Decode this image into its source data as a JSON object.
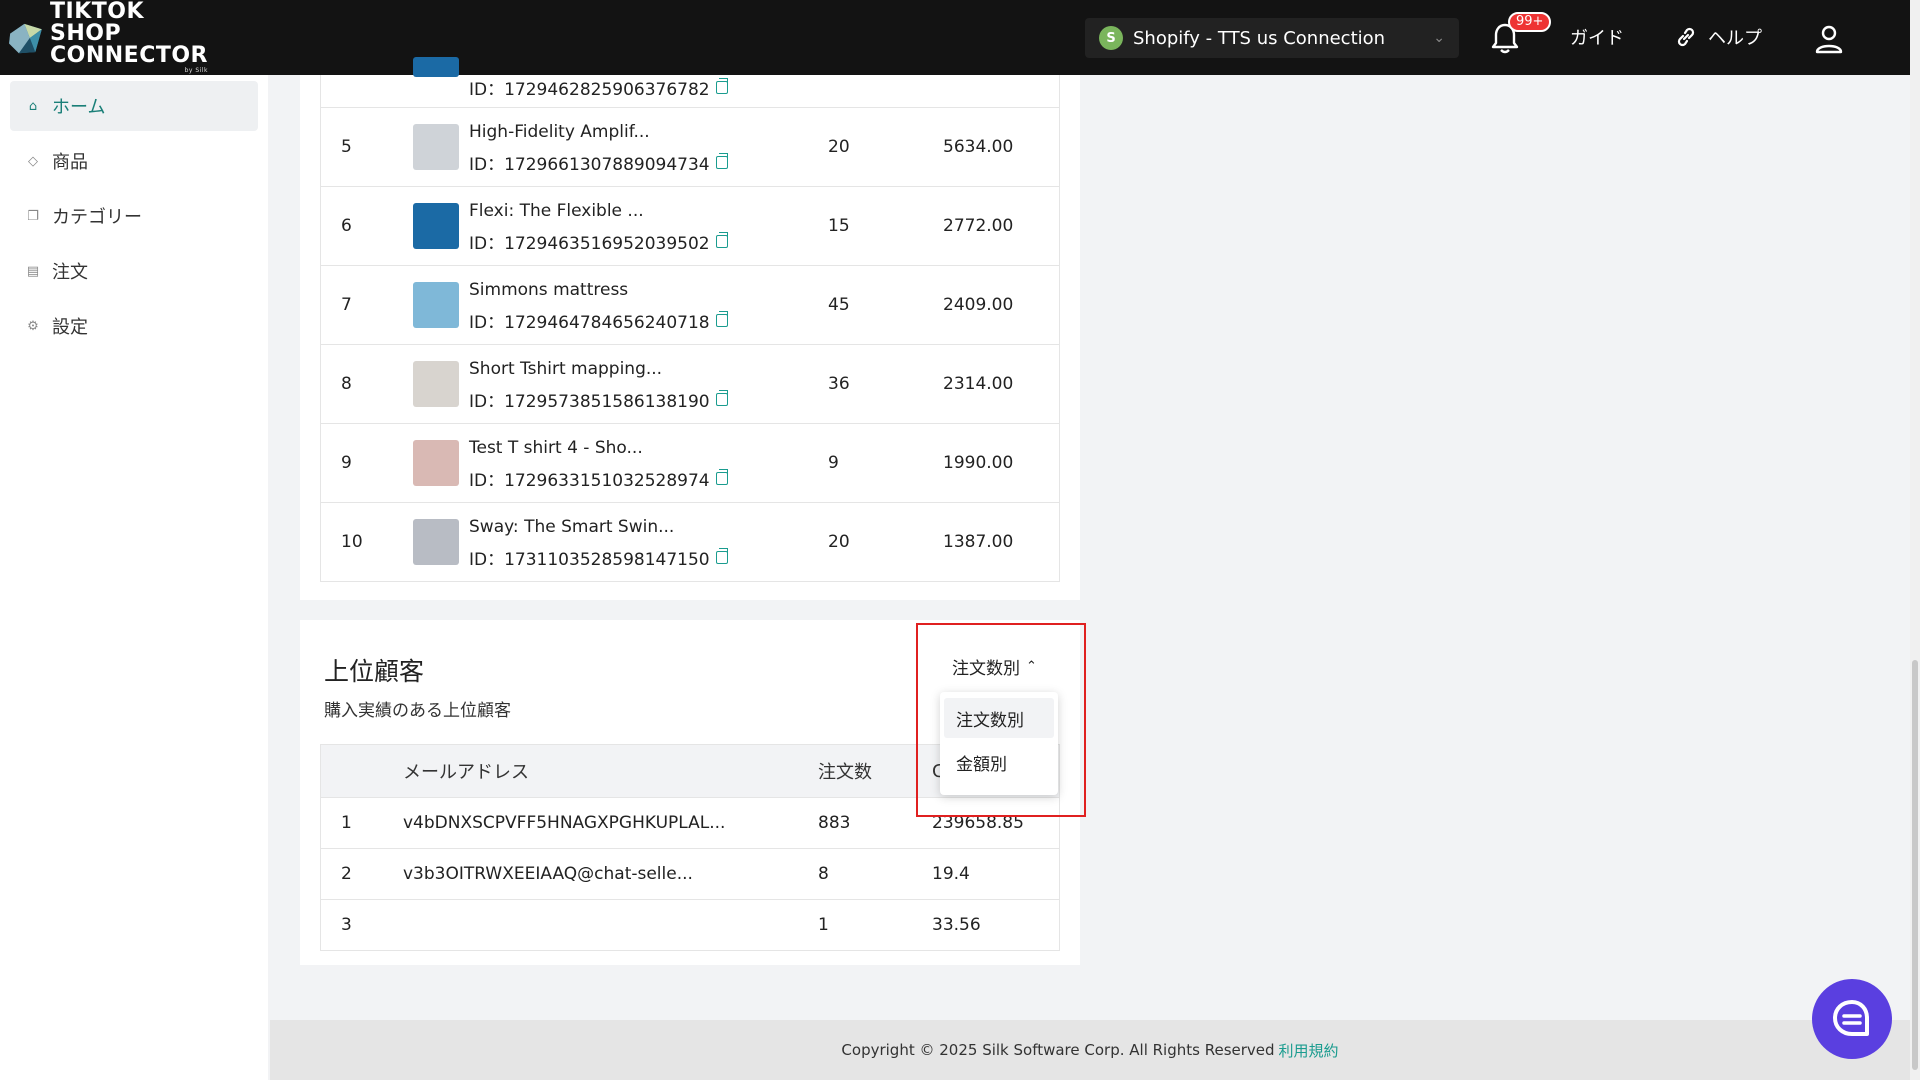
{
  "header": {
    "logo_line1": "TIKTOK SHOP",
    "logo_line2": "CONNECTOR",
    "logo_by": "by Silk",
    "store_name": "Shopify - TTS us Connection",
    "notification_badge": "99+",
    "guide_label": "ガイド",
    "help_label": "ヘルプ"
  },
  "sidebar": {
    "items": [
      {
        "label": "ホーム",
        "icon": "home-icon"
      },
      {
        "label": "商品",
        "icon": "tag-icon"
      },
      {
        "label": "カテゴリー",
        "icon": "category-icon"
      },
      {
        "label": "注文",
        "icon": "order-icon"
      },
      {
        "label": "設定",
        "icon": "settings-icon"
      }
    ]
  },
  "products": {
    "partial_id": "ID：1729462825906376782",
    "rows": [
      {
        "rank": "5",
        "name": "High-Fidelity Amplif...",
        "id": "ID：1729661307889094734",
        "qty": "20",
        "amount": "5634.00",
        "thumb": "#cfd3d8"
      },
      {
        "rank": "6",
        "name": "Flexi: The Flexible ...",
        "id": "ID：1729463516952039502",
        "qty": "15",
        "amount": "2772.00",
        "thumb": "#1b6aa5"
      },
      {
        "rank": "7",
        "name": "Simmons mattress",
        "id": "ID：1729464784656240718",
        "qty": "45",
        "amount": "2409.00",
        "thumb": "#7fb8d8"
      },
      {
        "rank": "8",
        "name": "Short Tshirt mapping...",
        "id": "ID：1729573851586138190",
        "qty": "36",
        "amount": "2314.00",
        "thumb": "#d8d4cf"
      },
      {
        "rank": "9",
        "name": "Test T shirt 4 - Sho...",
        "id": "ID：1729633151032528974",
        "qty": "9",
        "amount": "1990.00",
        "thumb": "#d9b9b4"
      },
      {
        "rank": "10",
        "name": "Sway: The Smart Swin...",
        "id": "ID：1731103528598147150",
        "qty": "20",
        "amount": "1387.00",
        "thumb": "#b8bcc4"
      }
    ]
  },
  "customers": {
    "title": "上位顧客",
    "subtitle": "購入実績のある上位顧客",
    "sort_label": "注文数別",
    "headers": {
      "email": "メールアドレス",
      "orders": "注文数",
      "amount": "C"
    },
    "rows": [
      {
        "rank": "1",
        "email": "v4bDNXSCPVFF5HNAGXPGHKUPLAL...",
        "orders": "883",
        "amount": "239658.85"
      },
      {
        "rank": "2",
        "email": "v3b3OITRWXEEIAAQ@chat-selle...",
        "orders": "8",
        "amount": "19.4"
      },
      {
        "rank": "3",
        "email": "",
        "orders": "1",
        "amount": "33.56"
      }
    ]
  },
  "dropdown": {
    "options": [
      "注文数別",
      "金額別"
    ]
  },
  "footer": {
    "copyright": "Copyright © 2025 Silk Software Corp. All Rights Reserved",
    "terms_link": "利用規約"
  }
}
